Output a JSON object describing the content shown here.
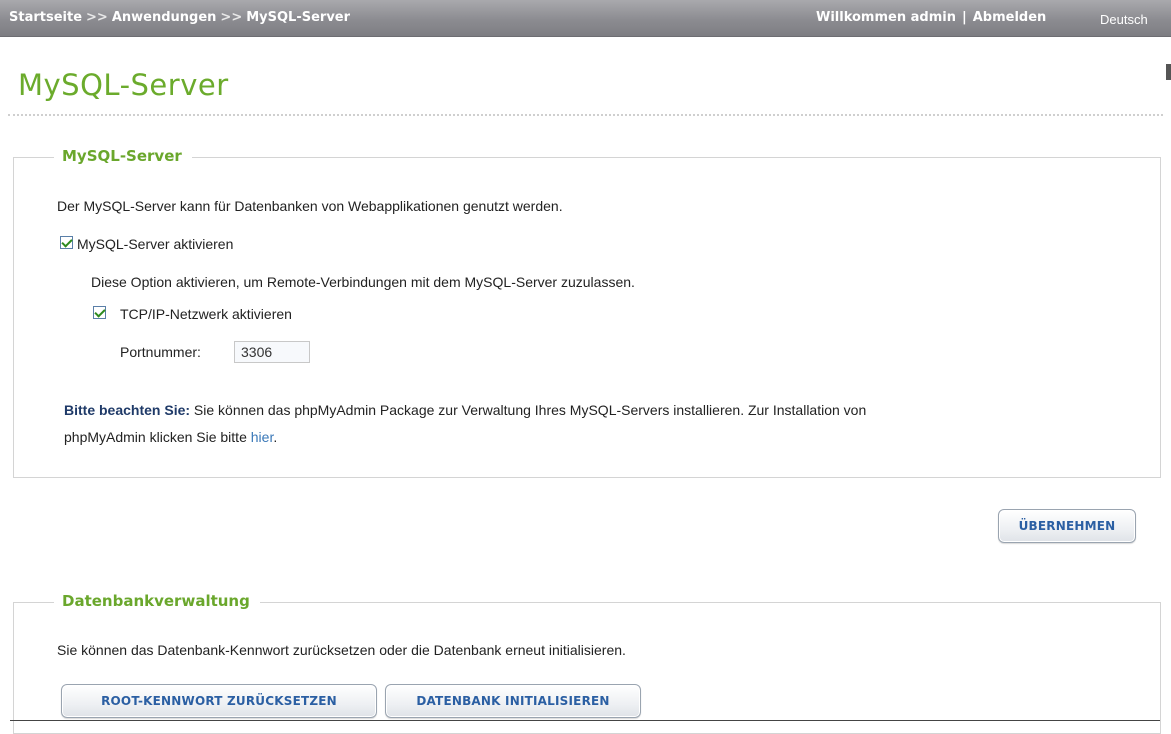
{
  "topbar": {
    "breadcrumb": [
      "Startseite",
      "Anwendungen",
      "MySQL-Server"
    ],
    "separator": ">>",
    "welcome": "Willkommen admin",
    "logout": "Abmelden",
    "pipe": "|",
    "language": "Deutsch"
  },
  "page": {
    "title": "MySQL-Server"
  },
  "mysql_panel": {
    "legend": "MySQL-Server",
    "description": "Der MySQL-Server kann für Datenbanken von Webapplikationen genutzt werden.",
    "enable_label": "MySQL-Server aktivieren",
    "enable_checked": true,
    "remote_hint": "Diese Option aktivieren, um Remote-Verbindungen mit dem MySQL-Server zuzulassen.",
    "tcp_label": "TCP/IP-Netzwerk aktivieren",
    "tcp_checked": true,
    "port_label": "Portnummer:",
    "port_value": "3306",
    "note_bold": "Bitte beachten Sie:",
    "note_text_1": " Sie können das phpMyAdmin Package zur Verwaltung Ihres MySQL-Servers installieren. Zur Installation von",
    "note_text_2": "phpMyAdmin klicken Sie bitte ",
    "note_link": "hier",
    "note_end": "."
  },
  "apply_button": "ÜBERNEHMEN",
  "db_panel": {
    "legend": "Datenbankverwaltung",
    "description": "Sie können das Datenbank-Kennwort zurücksetzen oder die Datenbank erneut initialisieren.",
    "reset_button": "ROOT-KENNWORT ZURÜCKSETZEN",
    "init_button": "DATENBANK INITIALISIEREN"
  },
  "colors": {
    "accent_green": "#6bab2c",
    "link_blue": "#3a78b8",
    "button_text": "#2b5fa3",
    "topbar": "#8c8c91"
  }
}
